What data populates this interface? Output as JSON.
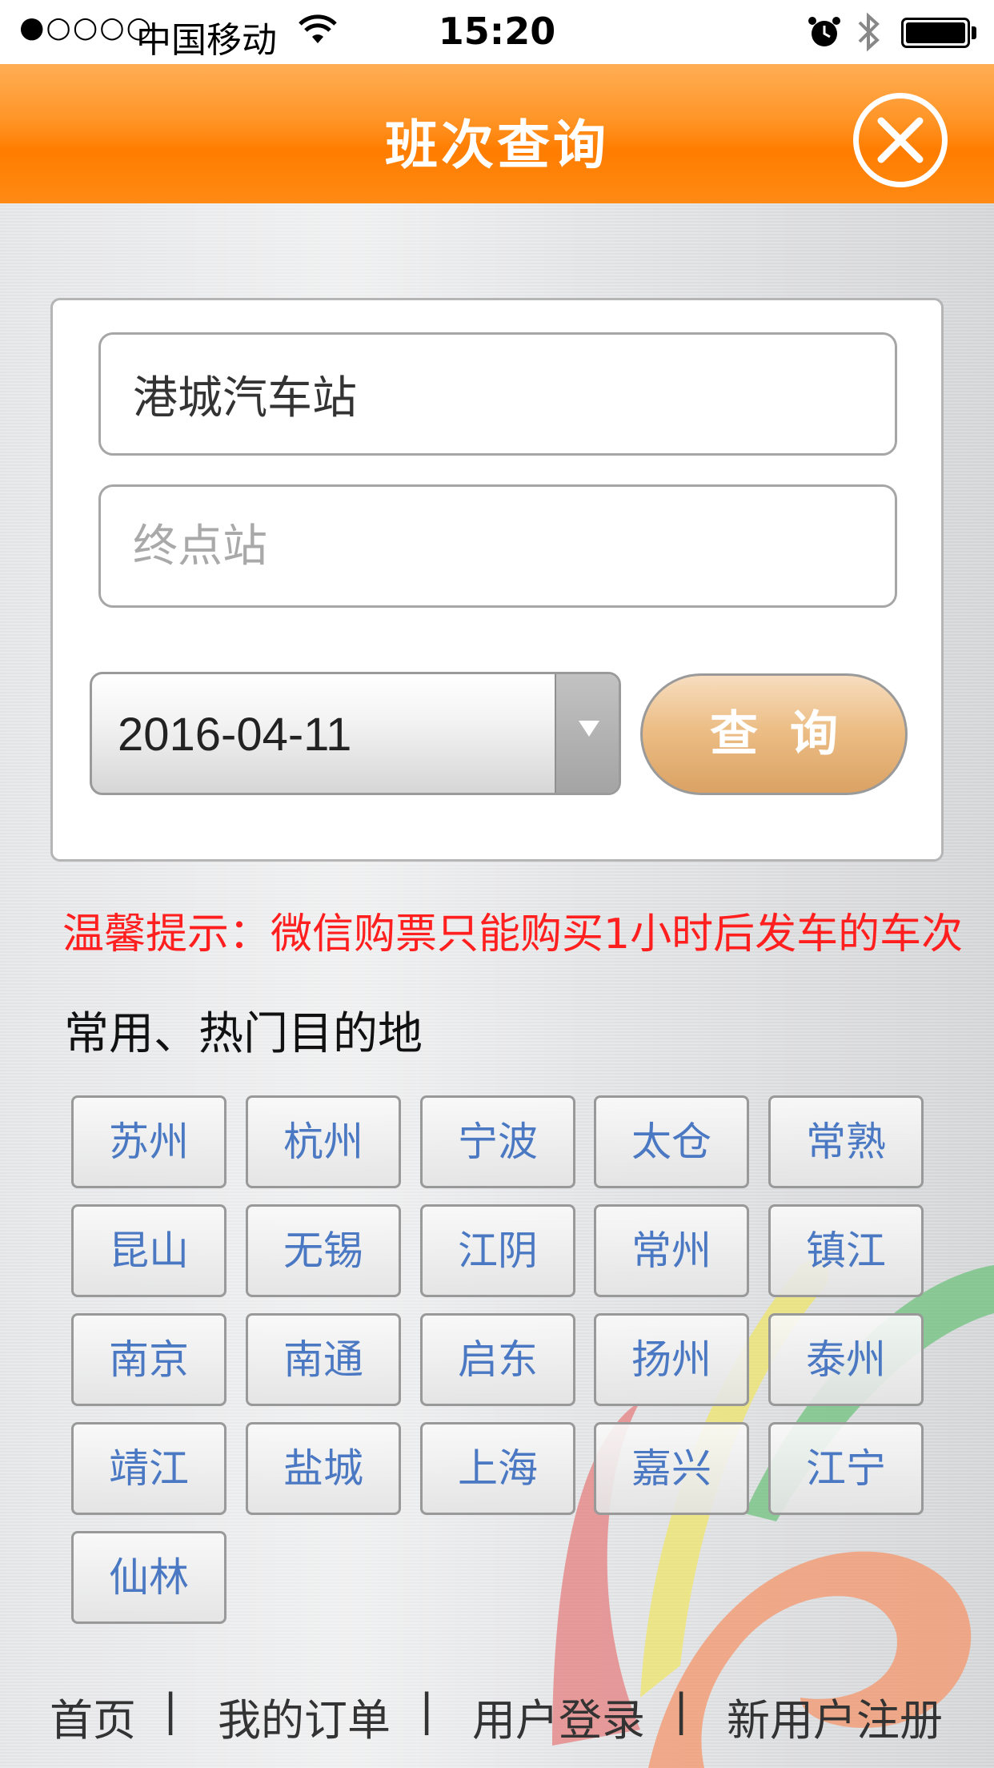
{
  "status_bar": {
    "signal": "●○○○○",
    "carrier": "中国移动",
    "time": "15:20"
  },
  "header": {
    "title": "班次查询"
  },
  "form": {
    "start_value": "港城汽车站",
    "end_placeholder": "终点站",
    "date": "2016-04-11",
    "query_label": "查询"
  },
  "notice": "温馨提示：微信购票只能购买1小时后发车的车次",
  "section_title": "常用、热门目的地",
  "destinations": [
    "苏州",
    "杭州",
    "宁波",
    "太仓",
    "常熟",
    "昆山",
    "无锡",
    "江阴",
    "常州",
    "镇江",
    "南京",
    "南通",
    "启东",
    "扬州",
    "泰州",
    "靖江",
    "盐城",
    "上海",
    "嘉兴",
    "江宁",
    "仙林"
  ],
  "footer": {
    "links": [
      "首页",
      "我的订单",
      "用户登录",
      "新用户注册"
    ],
    "separator": "|"
  },
  "colors": {
    "header_orange": "#ff7d00",
    "notice_red": "#ff1f1f",
    "dest_text_blue": "#4a78c2",
    "query_button": "#ecbe86"
  },
  "icons": [
    "wifi-icon",
    "alarm-icon",
    "bluetooth-icon",
    "battery-icon",
    "close-icon",
    "chevron-down-icon"
  ]
}
